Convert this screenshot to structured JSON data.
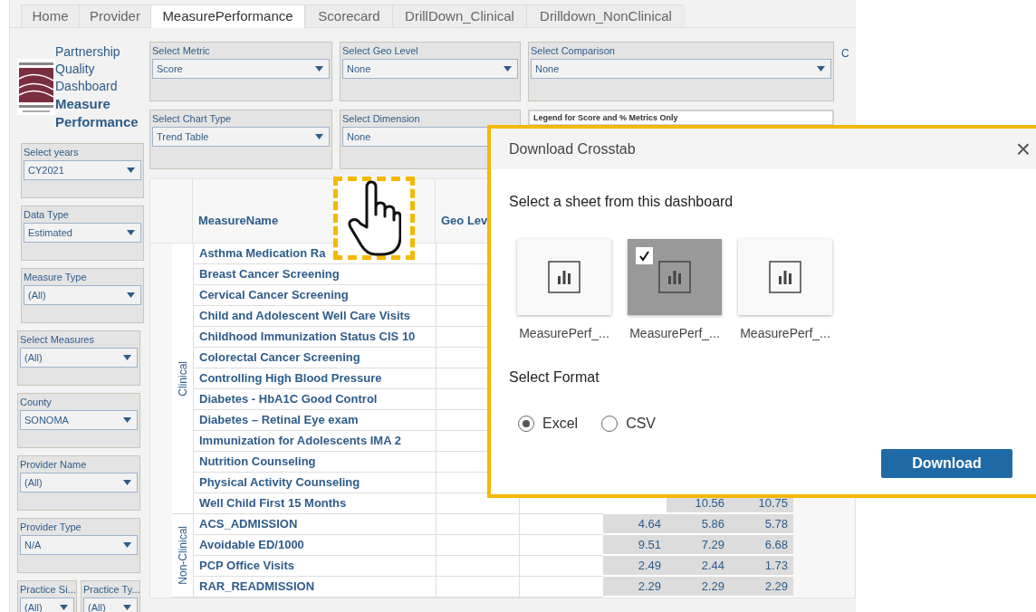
{
  "tabs": [
    {
      "label": "Home",
      "selected": false
    },
    {
      "label": "Provider",
      "selected": false
    },
    {
      "label": "MeasurePerformance",
      "selected": true
    },
    {
      "label": "Scorecard",
      "selected": false
    },
    {
      "label": "DrillDown_Clinical",
      "selected": false
    },
    {
      "label": "Drilldown_NonClinical",
      "selected": false
    }
  ],
  "title": {
    "lines": [
      "Partnership",
      "Quality",
      "Dashboard"
    ],
    "emphasis": [
      "Measure",
      "Performance"
    ]
  },
  "side_filters": [
    {
      "label": "Select years",
      "value": "CY2021"
    },
    {
      "label": "Data Type",
      "value": "Estimated"
    },
    {
      "label": "Measure Type",
      "value": "(All)"
    },
    {
      "label": "Select Measures",
      "value": "(All)"
    },
    {
      "label": "County",
      "value": "SONOMA"
    },
    {
      "label": "Provider Name",
      "value": "(All)"
    },
    {
      "label": "Provider Type",
      "value": "N/A"
    }
  ],
  "bottom_filters": [
    {
      "label": "Practice Si...",
      "value": "(All)"
    },
    {
      "label": "Practice Ty...",
      "value": "(All)"
    }
  ],
  "top_filters": [
    {
      "kind": "dropdown",
      "label": "Select Metric",
      "value": "Score"
    },
    {
      "kind": "dropdown",
      "label": "Select Geo Level",
      "value": "None"
    },
    {
      "kind": "dropdown",
      "label": "Select Comparison",
      "value": "None"
    },
    {
      "kind": "dropdown",
      "label": "Select Chart Type",
      "value": "Trend Table"
    },
    {
      "kind": "dropdown",
      "label": "Select Dimension",
      "value": "None"
    },
    {
      "kind": "legend",
      "label": "Legend for Score and % Metrics Only"
    }
  ],
  "clipped_filter_label": "C",
  "table": {
    "columns": [
      "MeasureName",
      "Geo Lev"
    ],
    "groups": [
      {
        "label": "Clinical",
        "rows": [
          {
            "name": "Asthma Medication Ra"
          },
          {
            "name": "Breast Cancer Screening"
          },
          {
            "name": "Cervical Cancer Screening"
          },
          {
            "name": "Child and Adolescent Well Care Visits"
          },
          {
            "name": "Childhood Immunization Status CIS 10"
          },
          {
            "name": "Colorectal Cancer Screening"
          },
          {
            "name": "Controlling High Blood Pressure"
          },
          {
            "name": "Diabetes - HbA1C Good Control"
          },
          {
            "name": "Diabetes – Retinal Eye exam"
          },
          {
            "name": "Immunization for Adolescents IMA 2"
          },
          {
            "name": "Nutrition Counseling"
          },
          {
            "name": "Physical Activity Counseling"
          },
          {
            "name": "Well Child First 15 Months",
            "values": [
              "10.56",
              "10.75"
            ]
          }
        ]
      },
      {
        "label": "Non-Clinical",
        "rows": [
          {
            "name": "ACS_ADMISSION",
            "values": [
              "4.64",
              "5.86",
              "5.78"
            ]
          },
          {
            "name": "Avoidable ED/1000",
            "values": [
              "9.51",
              "7.29",
              "6.68"
            ]
          },
          {
            "name": "PCP Office Visits",
            "values": [
              "2.49",
              "2.44",
              "1.73"
            ]
          },
          {
            "name": "RAR_READMISSION",
            "values": [
              "2.29",
              "2.29",
              "2.29"
            ]
          }
        ]
      }
    ]
  },
  "dialog": {
    "title": "Download Crosstab",
    "close": "×",
    "sheet_heading": "Select a sheet from this dashboard",
    "sheets": [
      {
        "label": "MeasurePerf_...",
        "selected": false
      },
      {
        "label": "MeasurePerf_...",
        "selected": true
      },
      {
        "label": "MeasurePerf_...",
        "selected": false
      }
    ],
    "format_heading": "Select Format",
    "formats": [
      {
        "label": "Excel",
        "selected": true
      },
      {
        "label": "CSV",
        "selected": false
      }
    ],
    "button": "Download"
  }
}
